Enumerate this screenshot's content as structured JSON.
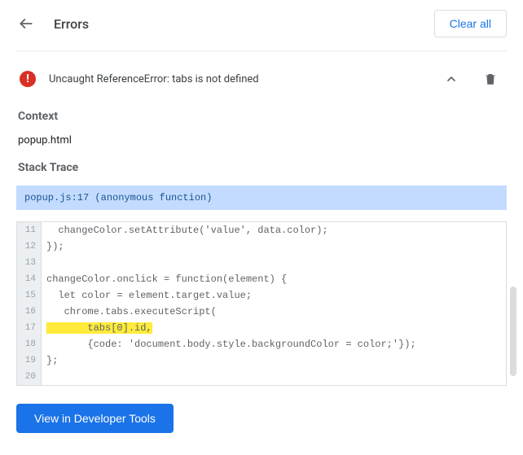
{
  "header": {
    "title": "Errors",
    "clear_label": "Clear all"
  },
  "error": {
    "message": "Uncaught ReferenceError: tabs is not defined"
  },
  "context": {
    "heading": "Context",
    "value": "popup.html"
  },
  "stack": {
    "heading": "Stack Trace",
    "frame": "popup.js:17 (anonymous function)"
  },
  "code": {
    "lines": [
      {
        "num": "11",
        "text": "  changeColor.setAttribute('value', data.color);",
        "hl": false
      },
      {
        "num": "12",
        "text": "});",
        "hl": false
      },
      {
        "num": "13",
        "text": "",
        "hl": false
      },
      {
        "num": "14",
        "text": "changeColor.onclick = function(element) {",
        "hl": false
      },
      {
        "num": "15",
        "text": "  let color = element.target.value;",
        "hl": false
      },
      {
        "num": "16",
        "text": "   chrome.tabs.executeScript(",
        "hl": false
      },
      {
        "num": "17",
        "text": "       tabs[0].id,",
        "hl": true
      },
      {
        "num": "18",
        "text": "       {code: 'document.body.style.backgroundColor = color;'});",
        "hl": false
      },
      {
        "num": "19",
        "text": "};",
        "hl": false
      },
      {
        "num": "20",
        "text": "",
        "hl": false
      }
    ]
  },
  "footer": {
    "view_label": "View in Developer Tools"
  }
}
